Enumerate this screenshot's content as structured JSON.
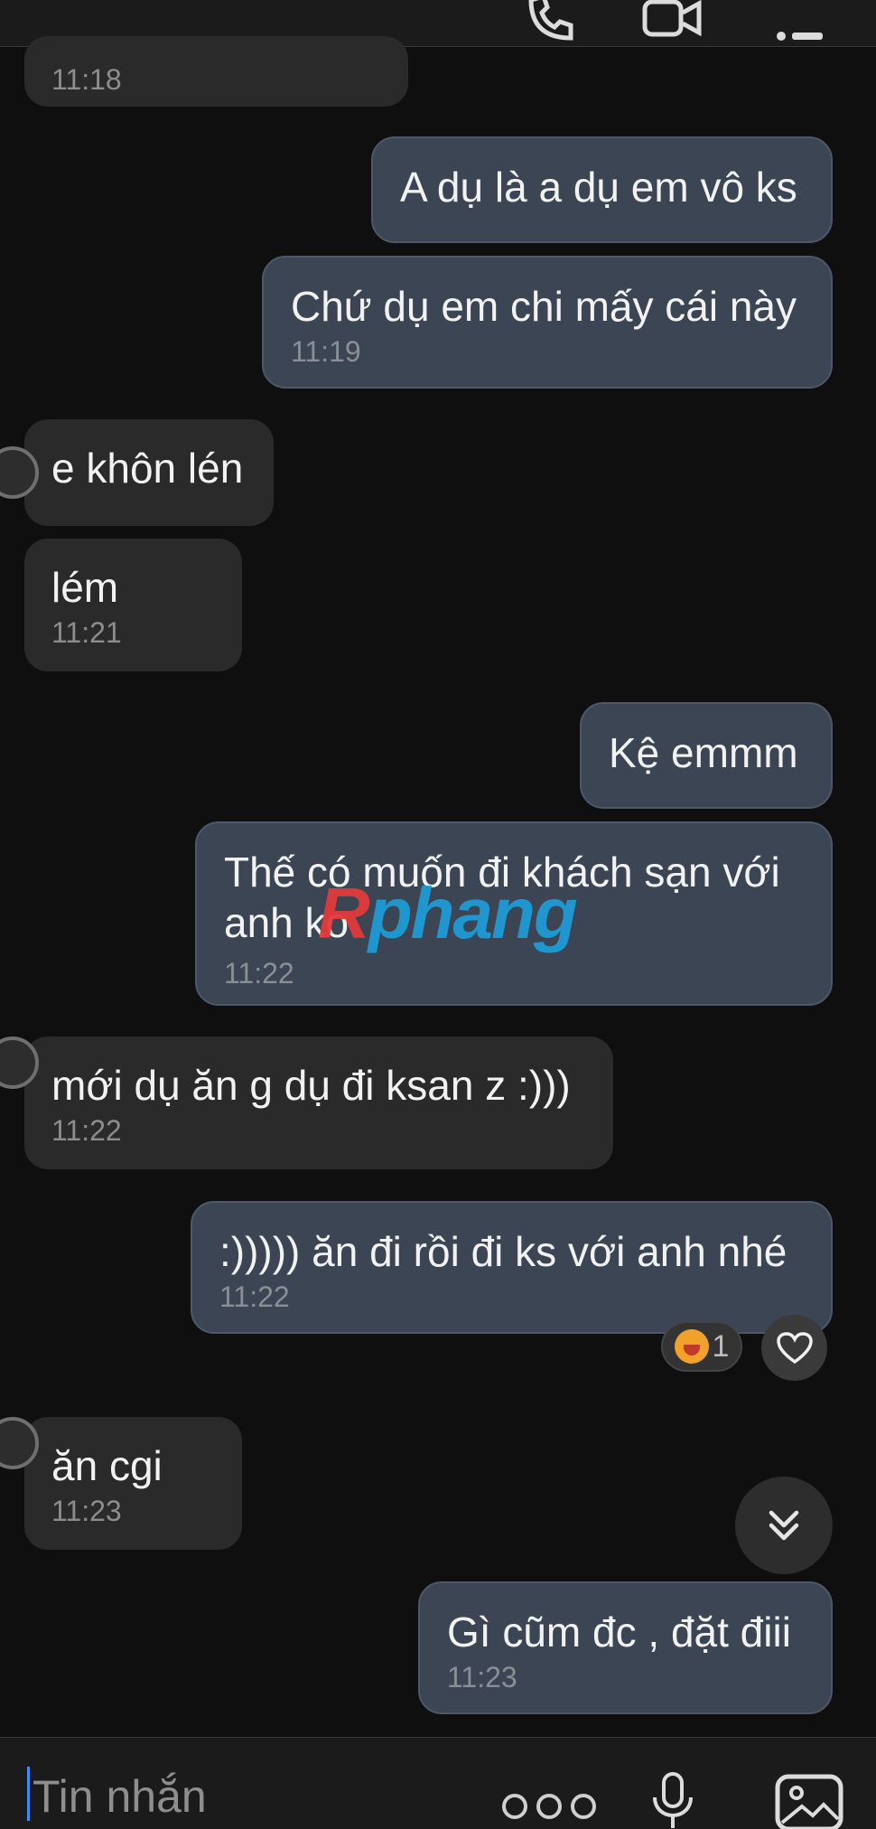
{
  "header": {
    "icons": [
      "phone-icon",
      "video-icon",
      "menu-icon"
    ]
  },
  "messages": [
    {
      "dir": "in",
      "text": "",
      "time": "11:18"
    },
    {
      "dir": "out",
      "text": "A dụ là a dụ em vô ks",
      "time": ""
    },
    {
      "dir": "out",
      "text": "Chứ dụ em chi mấy cái này",
      "time": "11:19"
    },
    {
      "dir": "in",
      "text": "e khôn lén",
      "time": ""
    },
    {
      "dir": "in",
      "text": "lém",
      "time": "11:21"
    },
    {
      "dir": "out",
      "text": "Kệ emmm",
      "time": ""
    },
    {
      "dir": "out",
      "text": "Thế có muốn đi khách sạn với\nanh ko",
      "time": "11:22"
    },
    {
      "dir": "in",
      "text": "mới dụ ăn g dụ đi ksan z :)))",
      "time": "11:22"
    },
    {
      "dir": "out",
      "text": ":))))) ăn đi rồi đi ks với anh nhé",
      "time": "11:22"
    },
    {
      "dir": "in",
      "text": "ăn cgi",
      "time": "11:23"
    },
    {
      "dir": "out",
      "text": "Gì cũm đc , đặt điii",
      "time": "11:23"
    }
  ],
  "reaction": {
    "emoji_icon": "laughing-emoji-icon",
    "count": "1"
  },
  "watermark": {
    "prefix": "R",
    "text": "phang"
  },
  "composer": {
    "placeholder": "Tin nhắn"
  },
  "colors": {
    "background": "#0f0f0f",
    "incoming": "#2a2a2a",
    "outgoing": "#3b4553",
    "accent": "#3d8cff"
  }
}
